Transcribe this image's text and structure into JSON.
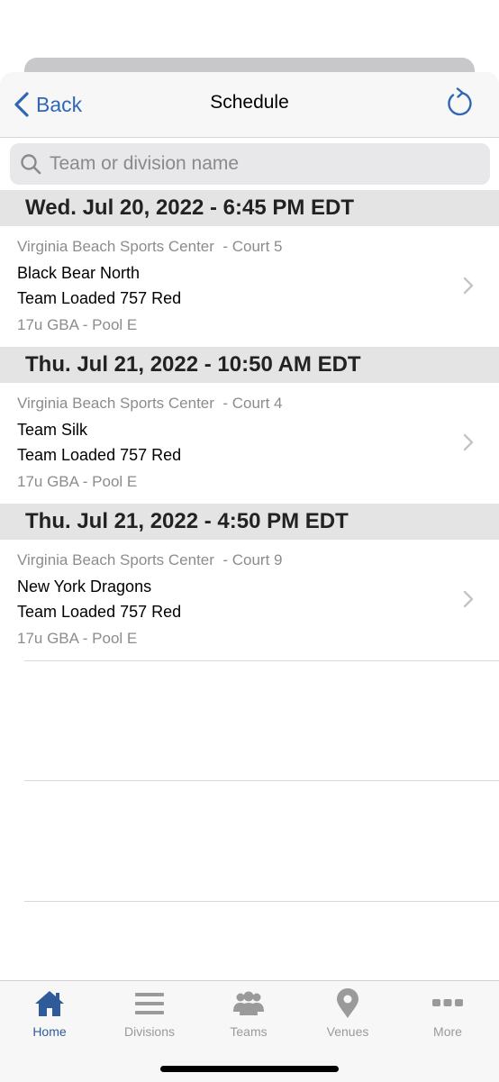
{
  "colors": {
    "accent": "#2f67b5",
    "tab_active": "#2f5b9a",
    "tab_inactive": "#9a9a9a",
    "section_bg": "#e4e4e4"
  },
  "navbar": {
    "back_label": "Back",
    "back_icon": "chevron-left-icon",
    "title": "Schedule",
    "refresh_icon": "refresh-icon"
  },
  "search": {
    "placeholder": "Team or division name",
    "value": "",
    "icon": "search-icon"
  },
  "schedule": [
    {
      "header": "Wed. Jul 20, 2022 - 6:45 PM EDT",
      "venue": "Virginia Beach Sports Center  - Court 5",
      "team1": "Black Bear North",
      "team2": "Team Loaded 757 Red",
      "division": "17u GBA - Pool E"
    },
    {
      "header": "Thu. Jul 21, 2022 - 10:50 AM EDT",
      "venue": "Virginia Beach Sports Center  - Court 4",
      "team1": "Team Silk",
      "team2": "Team Loaded 757 Red",
      "division": "17u GBA - Pool E"
    },
    {
      "header": "Thu. Jul 21, 2022 - 4:50 PM EDT",
      "venue": "Virginia Beach Sports Center  - Court 9",
      "team1": "New York Dragons",
      "team2": "Team Loaded 757 Red",
      "division": "17u GBA - Pool E"
    }
  ],
  "tabbar": {
    "selected": "Home",
    "tabs": [
      {
        "label": "Home",
        "icon": "home-icon"
      },
      {
        "label": "Divisions",
        "icon": "list-icon"
      },
      {
        "label": "Teams",
        "icon": "people-icon"
      },
      {
        "label": "Venues",
        "icon": "map-pin-icon"
      },
      {
        "label": "More",
        "icon": "more-dots-icon"
      }
    ]
  }
}
